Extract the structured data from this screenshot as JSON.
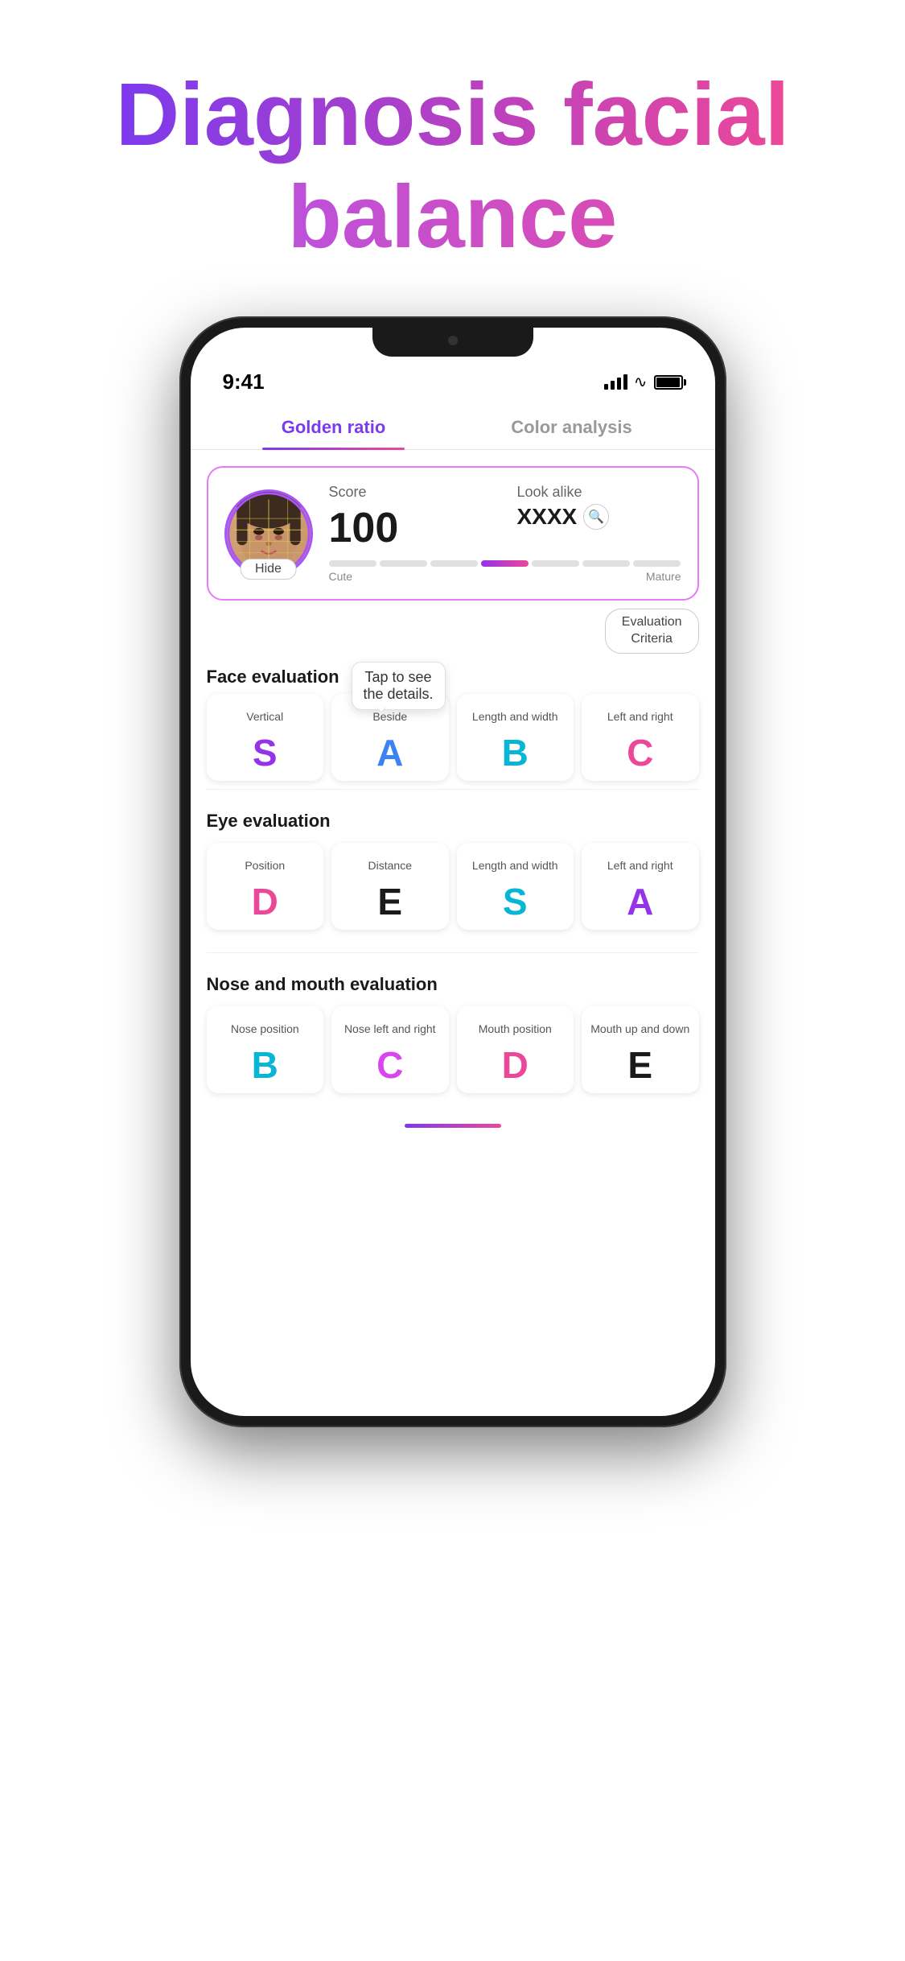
{
  "hero": {
    "line1": "Diagnosis facial",
    "line2": "balance"
  },
  "phone": {
    "statusBar": {
      "time": "9:41"
    },
    "tabs": [
      {
        "id": "golden-ratio",
        "label": "Golden ratio",
        "active": true
      },
      {
        "id": "color-analysis",
        "label": "Color analysis",
        "active": false
      }
    ],
    "scoreCard": {
      "scoreLabel": "Score",
      "scoreValue": "100",
      "lookAlikeLabel": "Look alike",
      "lookAlikeValue": "XXXX",
      "hideButtonLabel": "Hide",
      "cutenessLabels": [
        "Cute",
        "Mature"
      ],
      "evalCriteria": "Evaluation\nCriteria"
    },
    "faceEvalSection": {
      "title": "Face evaluation",
      "tooltip": "Tap to see\nthe details.",
      "grades": [
        {
          "label": "Vertical",
          "letter": "S",
          "colorClass": "grade-purple"
        },
        {
          "label": "Beside",
          "letter": "A",
          "colorClass": "grade-blue"
        },
        {
          "label": "Length and width",
          "letter": "B",
          "colorClass": "grade-cyan"
        },
        {
          "label": "Left and right",
          "letter": "C",
          "colorClass": "grade-pink"
        }
      ]
    },
    "eyeEvalSection": {
      "title": "Eye evaluation",
      "grades": [
        {
          "label": "Position",
          "letter": "D",
          "colorClass": "grade-pink"
        },
        {
          "label": "Distance",
          "letter": "E",
          "colorClass": "grade-dark"
        },
        {
          "label": "Length and width",
          "letter": "S",
          "colorClass": "grade-cyan"
        },
        {
          "label": "Left and right",
          "letter": "A",
          "colorClass": "grade-purple"
        }
      ]
    },
    "noseMouthSection": {
      "title": "Nose and mouth evaluation",
      "grades": [
        {
          "label": "Nose position",
          "letter": "B",
          "colorClass": "grade-cyan"
        },
        {
          "label": "Nose left and right",
          "letter": "C",
          "colorClass": "grade-magenta"
        },
        {
          "label": "Mouth position",
          "letter": "D",
          "colorClass": "grade-pink"
        },
        {
          "label": "Mouth up and down",
          "letter": "E",
          "colorClass": "grade-dark"
        }
      ]
    }
  }
}
